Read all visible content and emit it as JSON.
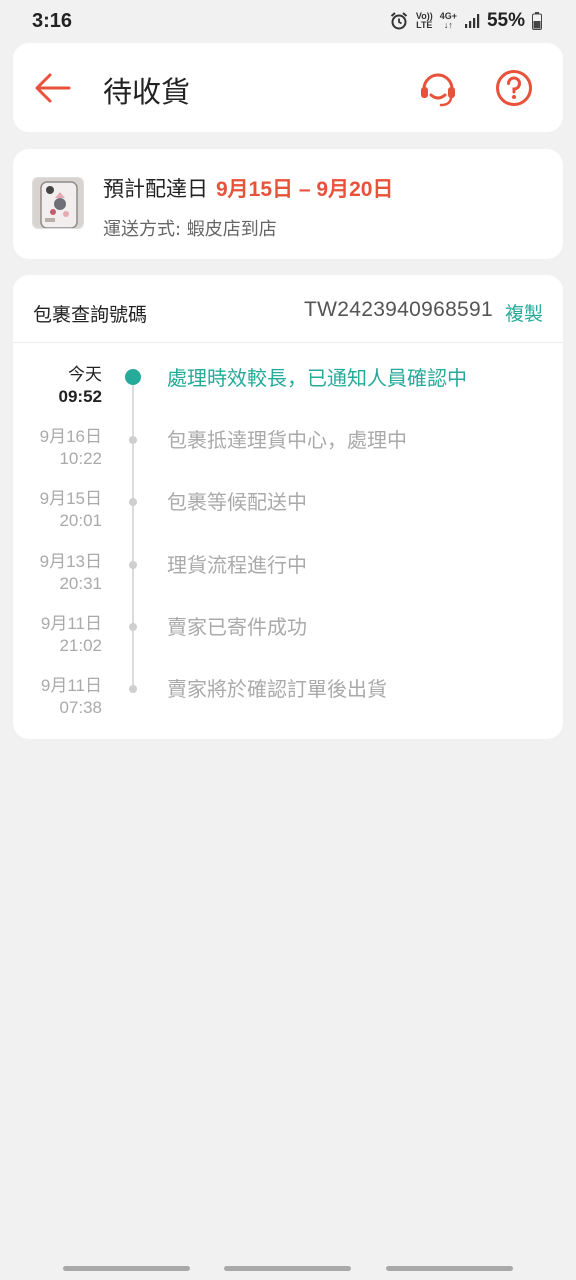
{
  "status_bar": {
    "time": "3:16",
    "volte_top": "Vo))",
    "volte_bottom": "LTE",
    "net_top": "4G+",
    "net_bottom": "↓↑",
    "battery": "55%",
    "icons": [
      "alarm-icon",
      "volte-icon",
      "network-4g-icon",
      "signal-icon",
      "battery-icon"
    ]
  },
  "header": {
    "title": "待收貨",
    "back_icon": "arrow-left-icon",
    "support_icon": "headset-icon",
    "help_icon": "question-circle-icon"
  },
  "delivery": {
    "eta_label": "預計配達日",
    "eta_range": "9月15日 – 9月20日",
    "ship_method": "運送方式: 蝦皮店到店",
    "thumbnail": "product-thumbnail"
  },
  "tracking": {
    "label": "包裹查詢號碼",
    "number": "TW2423940968591",
    "copy": "複製",
    "events": [
      {
        "date": "今天",
        "time": "09:52",
        "text": "處理時效較長，已通知人員確認中",
        "active": true
      },
      {
        "date": "9月16日",
        "time": "10:22",
        "text": "包裹抵達理貨中心，處理中",
        "active": false
      },
      {
        "date": "9月15日",
        "time": "20:01",
        "text": "包裹等候配送中",
        "active": false
      },
      {
        "date": "9月13日",
        "time": "20:31",
        "text": "理貨流程進行中",
        "active": false
      },
      {
        "date": "9月11日",
        "time": "21:02",
        "text": "賣家已寄件成功",
        "active": false
      },
      {
        "date": "9月11日",
        "time": "07:38",
        "text": "賣家將於確認訂單後出貨",
        "active": false
      }
    ]
  },
  "colors": {
    "accent": "#e8513a",
    "teal": "#26aa99",
    "background": "#f1f1f1"
  }
}
